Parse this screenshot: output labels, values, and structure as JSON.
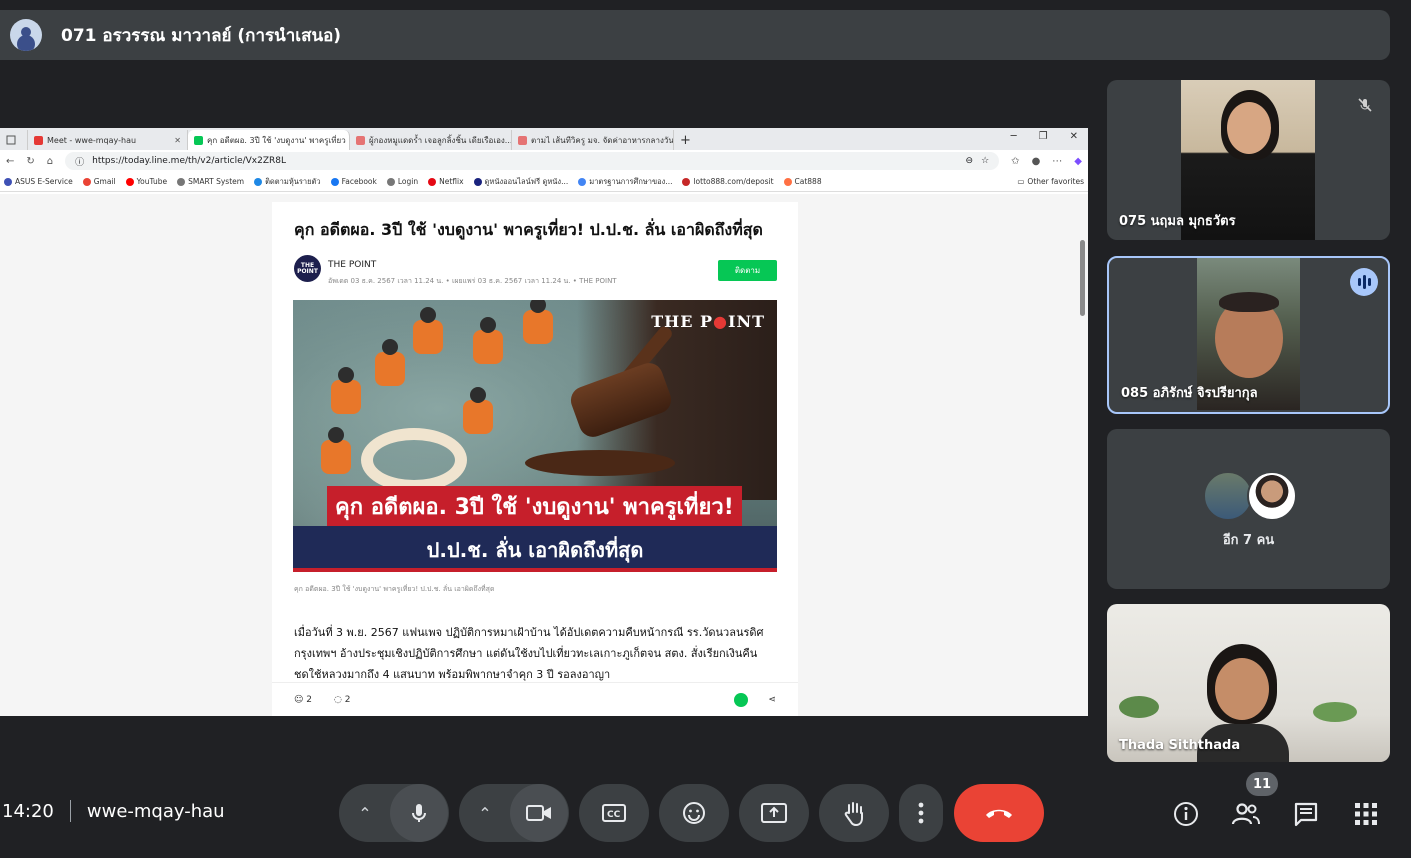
{
  "presenter": {
    "name": "071 อรวรรณ มาวาลย์ (การนำเสนอ)"
  },
  "browser": {
    "tabs": [
      {
        "label": "Meet - wwe-mqay-hau",
        "color": "#e53935"
      },
      {
        "label": "คุก อดีตผอ. 3ปี ใช้ 'งบดูงาน' พาครูเที่ยว",
        "color": "#06c755"
      },
      {
        "label": "ผู้กองหมูแดดร้ำ เจอลูกลิ้งชิ้น เดียเรือเอง...",
        "color": "#e57373"
      },
      {
        "label": "ตามไ เส้นทีวิครู มจ. จัดค่าอาหารกลางวัน",
        "color": "#e57373"
      }
    ],
    "new_tab": "+",
    "url": "https://today.line.me/th/v2/article/Vx2ZR8L",
    "bookmarks": [
      {
        "label": "ASUS E-Service",
        "color": "#3f51b5"
      },
      {
        "label": "Gmail",
        "color": "#ea4335"
      },
      {
        "label": "YouTube",
        "color": "#ff0000"
      },
      {
        "label": "SMART System",
        "color": "#777777"
      },
      {
        "label": "ติดตามหุ้นรายตัว",
        "color": "#1e88e5"
      },
      {
        "label": "Facebook",
        "color": "#1877f2"
      },
      {
        "label": "Login",
        "color": "#777777"
      },
      {
        "label": "Netflix",
        "color": "#e50914"
      },
      {
        "label": "ดูหนังออนไลน์ฟรี ดูหนัง...",
        "color": "#1a237e"
      },
      {
        "label": "มาตรฐานการศึกษาของ...",
        "color": "#4285f4"
      },
      {
        "label": "lotto888.com/deposit",
        "color": "#c62828"
      },
      {
        "label": "Cat888",
        "color": "#ff7043"
      }
    ],
    "other_favorites": "Other favorites"
  },
  "article": {
    "title": "คุก อดีตผอ. 3ปี ใช้ 'งบดูงาน' พาครูเที่ยว! ป.ป.ช. ลั่น เอาผิดถึงที่สุด",
    "source_logo": "THE POINT",
    "source_name": "THE POINT",
    "meta": "อัพเดต 03 ธ.ค. 2567 เวลา 11.24 น. • เผยแพร่ 03 ธ.ค. 2567 เวลา 11.24 น. • THE POINT",
    "follow_label": "ติดตาม",
    "image_brand_a": "THE P",
    "image_brand_b": "INT",
    "image_caption_1": "คุก อดีตผอ. 3ปี ใช้ 'งบดูงาน' พาครูเที่ยว!",
    "image_caption_2": "ป.ป.ช. ลั่น เอาผิดถึงที่สุด",
    "caption": "คุก อดีตผอ. 3ปี ใช้ 'งบดูงาน' พาครูเที่ยว! ป.ป.ช. ลั่น เอาผิดถึงที่สุด",
    "body": "เมื่อวันที่ 3 พ.ย. 2567 แฟนเพจ ปฏิบัติการหมาเฝ้าบ้าน ได้อัปเดตความคืบหน้ากรณี รร.วัดนวลนรดิศ กรุงเทพฯ อ้างประชุมเชิงปฏิบัติการศึกษา แต่ดันใช้งบไปเที่ยวทะเลเกาะภูเก็ตจน สตง. สั่งเรียกเงินคืนชดใช้หลวงมากถึง 4 แสนบาท พร้อมพิพากษาจำคุก 3 ปี รอลงอาญา",
    "reactions": "2",
    "comments": "2"
  },
  "participants": [
    {
      "name": "075 นฤมล มุกธวัตร",
      "muted": true
    },
    {
      "name": "085 อภิรักษ์ จิรปรียากุล",
      "speaking": true
    },
    {
      "more_label": "อีก 7 คน"
    },
    {
      "name": "Thada Siththada"
    }
  ],
  "meeting": {
    "time": "14:20",
    "code": "wwe-mqay-hau",
    "people_count": "11"
  },
  "icons": {
    "mic": "microphone-icon",
    "camera": "camera-icon",
    "captions": "captions-icon",
    "emoji": "emoji-icon",
    "present": "present-screen-icon",
    "hand": "raise-hand-icon",
    "more": "more-options-icon",
    "end": "end-call-icon",
    "info": "info-icon",
    "people": "people-icon",
    "chat": "chat-icon",
    "activities": "activities-icon"
  },
  "colors": {
    "end_call": "#ea4335",
    "speaking_ring": "#a8c7fa",
    "line_green": "#06c755",
    "background": "#202124"
  }
}
